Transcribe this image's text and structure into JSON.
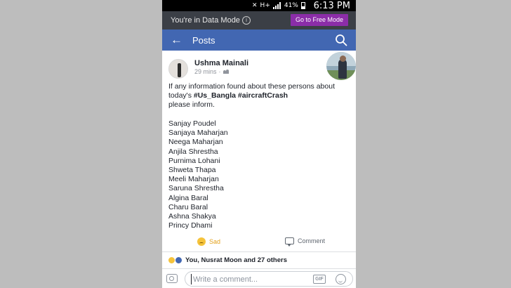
{
  "status_bar": {
    "network": "H+",
    "battery": "41%",
    "time": "6:13 PM"
  },
  "data_mode": {
    "label": "You're in Data Mode",
    "info_icon": "info-icon",
    "button_label": "Go to Free Mode"
  },
  "nav": {
    "back_icon": "arrow-left-icon",
    "title": "Posts",
    "search_icon": "search-icon"
  },
  "post": {
    "author": "Ushma Mainali",
    "time": "29 mins",
    "audience_icon": "friends-icon",
    "text_pre": "If any information found about these persons about today's ",
    "tag1": "#Us_Bangla",
    "tag2": "#aircraftCrash",
    "text_post": "please inform.",
    "names": [
      "Sanjay Poudel",
      "Sanjaya Maharjan",
      "Neega Maharjan",
      "Anjila Shrestha",
      "Purnima Lohani",
      "Shweta Thapa",
      "Meeli Maharjan",
      "Saruna Shrestha",
      "Algina Baral",
      "Charu Baral",
      "Ashna Shakya",
      "Princy Dhami"
    ]
  },
  "actions": {
    "sad_label": "Sad",
    "comment_label": "Comment"
  },
  "reactions_summary": "You, Nusrat Moon and 27 others",
  "comment_bar": {
    "placeholder": "Write a comment...",
    "gif_label": "GIF"
  },
  "colors": {
    "nav_blue": "#4267b2",
    "free_mode_purple": "#8b2da8",
    "sad_yellow": "#e3a21d"
  }
}
